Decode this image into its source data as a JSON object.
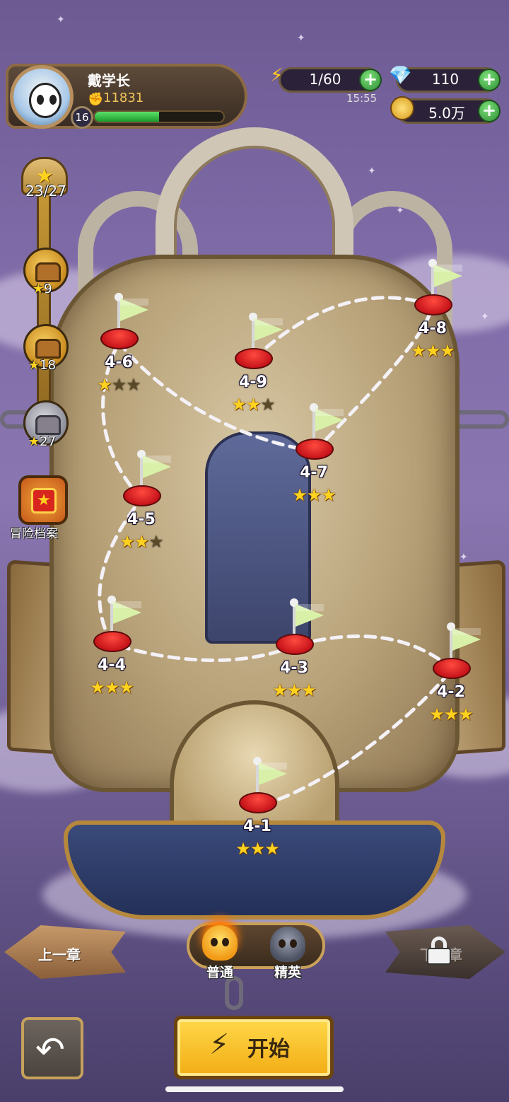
{
  "player": {
    "name": "戴学长",
    "power": "11831",
    "level": "16",
    "xp_fraction": 0.5
  },
  "resources": {
    "energy": "1/60",
    "energy_timer": "15:55",
    "gems": "110",
    "coins": "5.0万"
  },
  "icons": {
    "energy": "lightning-icon",
    "gems": "diamond-icon",
    "coins": "coin-icon",
    "plus": "plus-icon",
    "star": "star-icon",
    "chest": "treasure-chest-icon",
    "lock": "lock-icon",
    "back": "return-arrow-icon",
    "start": "lightning-icon"
  },
  "star_progress": {
    "count": "23/27",
    "chests": [
      {
        "requirement": "9"
      },
      {
        "requirement": "18"
      },
      {
        "requirement": "27"
      }
    ],
    "archive_label": "冒险档案"
  },
  "levels": [
    {
      "id": "4-1",
      "stars": 3
    },
    {
      "id": "4-2",
      "stars": 3
    },
    {
      "id": "4-3",
      "stars": 3
    },
    {
      "id": "4-4",
      "stars": 3
    },
    {
      "id": "4-5",
      "stars": 2
    },
    {
      "id": "4-6",
      "stars": 1
    },
    {
      "id": "4-7",
      "stars": 3
    },
    {
      "id": "4-8",
      "stars": 3
    },
    {
      "id": "4-9",
      "stars": 2
    }
  ],
  "navigation": {
    "prev_chapter": "上一章",
    "next_chapter": "下一章",
    "mode_normal": "普通",
    "mode_elite": "精英",
    "start": "开始"
  },
  "colors": {
    "accent": "#f2ac14",
    "star": "#ffd21f",
    "node_pad": "#c7141a",
    "flag": "#d9f0a8",
    "xp": "#3fc24a",
    "plus": "#2c8e33"
  }
}
